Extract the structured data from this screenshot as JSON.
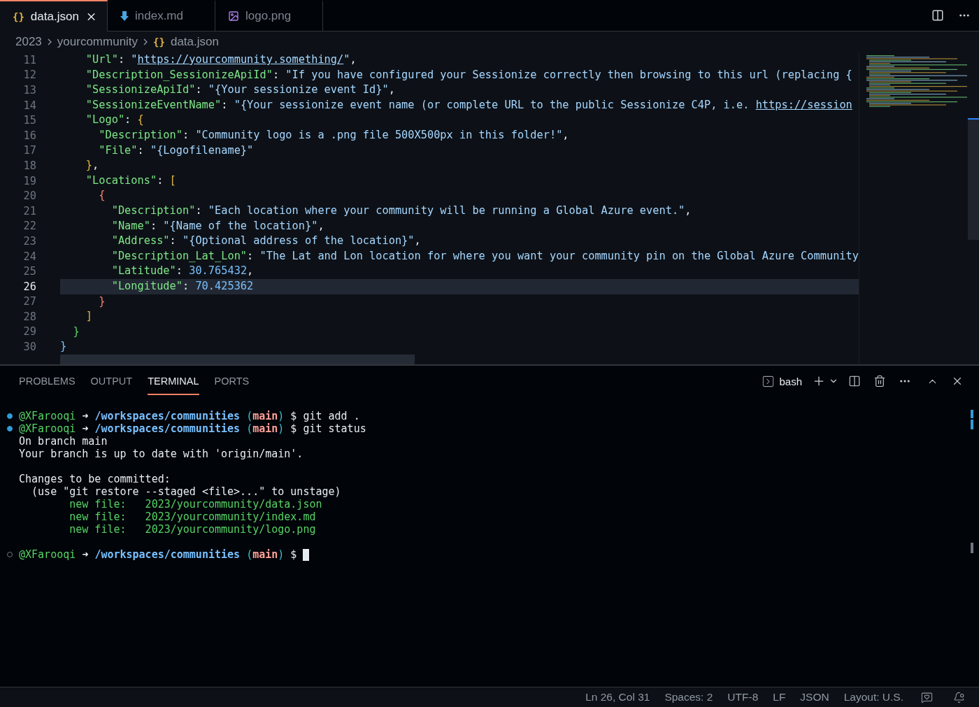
{
  "tabs": [
    {
      "kind": "json",
      "glyph": "{}",
      "label": "data.json",
      "selected": true
    },
    {
      "kind": "markdown",
      "label": "index.md",
      "selected": false
    },
    {
      "kind": "image",
      "label": "logo.png",
      "selected": false
    }
  ],
  "breadcrumb": [
    {
      "label": "2023"
    },
    {
      "label": "yourcommunity"
    },
    {
      "glyph": "{}",
      "label": "data.json"
    }
  ],
  "editor": {
    "lines": [
      {
        "number": "11",
        "current": false,
        "tokens": [
          {
            "kind": "key",
            "text": "    \"Url\""
          },
          {
            "kind": "punct",
            "text": ": "
          },
          {
            "kind": "string",
            "text": "\""
          },
          {
            "kind": "link",
            "text": "https://yourcommunity.something/"
          },
          {
            "kind": "string",
            "text": "\""
          },
          {
            "kind": "punct",
            "text": ","
          }
        ]
      },
      {
        "number": "12",
        "current": false,
        "tokens": [
          {
            "kind": "key",
            "text": "    \"Description_SessionizeApiId\""
          },
          {
            "kind": "punct",
            "text": ": "
          },
          {
            "kind": "string",
            "text": "\"If you have configured your Sessionize correctly then browsing to this url (replacing {"
          }
        ]
      },
      {
        "number": "13",
        "current": false,
        "tokens": [
          {
            "kind": "key",
            "text": "    \"SessionizeApiId\""
          },
          {
            "kind": "punct",
            "text": ": "
          },
          {
            "kind": "string",
            "text": "\"{Your sessionize event Id}\""
          },
          {
            "kind": "punct",
            "text": ","
          }
        ]
      },
      {
        "number": "14",
        "current": false,
        "tokens": [
          {
            "kind": "key",
            "text": "    \"SessionizeEventName\""
          },
          {
            "kind": "punct",
            "text": ": "
          },
          {
            "kind": "string",
            "text": "\"{Your sessionize event name (or complete URL to the public Sessionize C4P, i.e. "
          },
          {
            "kind": "link",
            "text": "https://session"
          }
        ]
      },
      {
        "number": "15",
        "current": false,
        "tokens": [
          {
            "kind": "key",
            "text": "    \"Logo\""
          },
          {
            "kind": "punct",
            "text": ": "
          },
          {
            "kind": "bracket",
            "text": "{",
            "color": "#e3b341"
          }
        ]
      },
      {
        "number": "16",
        "current": false,
        "tokens": [
          {
            "kind": "key",
            "text": "      \"Description\""
          },
          {
            "kind": "punct",
            "text": ": "
          },
          {
            "kind": "string",
            "text": "\"Community logo is a .png file 500X500px in this folder!\""
          },
          {
            "kind": "punct",
            "text": ","
          }
        ]
      },
      {
        "number": "17",
        "current": false,
        "tokens": [
          {
            "kind": "key",
            "text": "      \"File\""
          },
          {
            "kind": "punct",
            "text": ": "
          },
          {
            "kind": "string",
            "text": "\"{Logofilename}\""
          }
        ]
      },
      {
        "number": "18",
        "current": false,
        "tokens": [
          {
            "kind": "bracket",
            "text": "    }",
            "color": "#e3b341"
          },
          {
            "kind": "punct",
            "text": ","
          }
        ]
      },
      {
        "number": "19",
        "current": false,
        "tokens": [
          {
            "kind": "key",
            "text": "    \"Locations\""
          },
          {
            "kind": "punct",
            "text": ": "
          },
          {
            "kind": "bracket",
            "text": "[",
            "color": "#e3b341"
          }
        ]
      },
      {
        "number": "20",
        "current": false,
        "tokens": [
          {
            "kind": "bracket",
            "text": "      {",
            "color": "#ff7b72"
          }
        ]
      },
      {
        "number": "21",
        "current": false,
        "tokens": [
          {
            "kind": "key",
            "text": "        \"Description\""
          },
          {
            "kind": "punct",
            "text": ": "
          },
          {
            "kind": "string",
            "text": "\"Each location where your community will be running a Global Azure event.\""
          },
          {
            "kind": "punct",
            "text": ","
          }
        ]
      },
      {
        "number": "22",
        "current": false,
        "tokens": [
          {
            "kind": "key",
            "text": "        \"Name\""
          },
          {
            "kind": "punct",
            "text": ": "
          },
          {
            "kind": "string",
            "text": "\"{Name of the location}\""
          },
          {
            "kind": "punct",
            "text": ","
          }
        ]
      },
      {
        "number": "23",
        "current": false,
        "tokens": [
          {
            "kind": "key",
            "text": "        \"Address\""
          },
          {
            "kind": "punct",
            "text": ": "
          },
          {
            "kind": "string",
            "text": "\"{Optional address of the location}\""
          },
          {
            "kind": "punct",
            "text": ","
          }
        ]
      },
      {
        "number": "24",
        "current": false,
        "tokens": [
          {
            "kind": "key",
            "text": "        \"Description_Lat_Lon\""
          },
          {
            "kind": "punct",
            "text": ": "
          },
          {
            "kind": "string",
            "text": "\"The Lat and Lon location for where you want your community pin on the Global Azure Community"
          }
        ]
      },
      {
        "number": "25",
        "current": false,
        "tokens": [
          {
            "kind": "key",
            "text": "        \"Latitude\""
          },
          {
            "kind": "punct",
            "text": ": "
          },
          {
            "kind": "number",
            "text": "30.765432"
          },
          {
            "kind": "punct",
            "text": ","
          }
        ]
      },
      {
        "number": "26",
        "current": true,
        "tokens": [
          {
            "kind": "key",
            "text": "        \"Longitude\""
          },
          {
            "kind": "punct",
            "text": ": "
          },
          {
            "kind": "number",
            "text": "70.425362"
          }
        ]
      },
      {
        "number": "27",
        "current": false,
        "tokens": [
          {
            "kind": "bracket",
            "text": "      }",
            "color": "#ff7b72"
          }
        ]
      },
      {
        "number": "28",
        "current": false,
        "tokens": [
          {
            "kind": "bracket",
            "text": "    ]",
            "color": "#e3b341"
          }
        ]
      },
      {
        "number": "29",
        "current": false,
        "tokens": [
          {
            "kind": "bracket",
            "text": "  }",
            "color": "#56d364"
          }
        ]
      },
      {
        "number": "30",
        "current": false,
        "tokens": [
          {
            "kind": "bracket",
            "text": "}",
            "color": "#79c0ff"
          }
        ]
      }
    ]
  },
  "panel": {
    "tabs": [
      {
        "label": "PROBLEMS",
        "selected": false
      },
      {
        "label": "OUTPUT",
        "selected": false
      },
      {
        "label": "TERMINAL",
        "selected": true
      },
      {
        "label": "PORTS",
        "selected": false
      }
    ],
    "shell": "bash"
  },
  "terminal": {
    "lines": [
      {
        "kind": "prompt",
        "completed": true,
        "user": "@XFarooqi",
        "arrow": "➜",
        "path": "/workspaces/communities",
        "paren_open": "(",
        "branch": "main",
        "paren_close": ")",
        "command": "$ git add ."
      },
      {
        "kind": "prompt",
        "completed": true,
        "user": "@XFarooqi",
        "arrow": "➜",
        "path": "/workspaces/communities",
        "paren_open": "(",
        "branch": "main",
        "paren_close": ")",
        "command": "$ git status"
      },
      {
        "kind": "output",
        "text": "On branch main"
      },
      {
        "kind": "output",
        "text": "Your branch is up to date with 'origin/main'."
      },
      {
        "kind": "blank"
      },
      {
        "kind": "output",
        "text": "Changes to be committed:"
      },
      {
        "kind": "output",
        "text": "  (use \"git restore --staged <file>...\" to unstage)"
      },
      {
        "kind": "staged",
        "label": "new file:",
        "path": "2023/yourcommunity/data.json"
      },
      {
        "kind": "staged",
        "label": "new file:",
        "path": "2023/yourcommunity/index.md"
      },
      {
        "kind": "staged",
        "label": "new file:",
        "path": "2023/yourcommunity/logo.png"
      },
      {
        "kind": "blank"
      },
      {
        "kind": "prompt",
        "completed": false,
        "user": "@XFarooqi",
        "arrow": "➜",
        "path": "/workspaces/communities",
        "paren_open": "(",
        "branch": "main",
        "paren_close": ")",
        "command": "$",
        "cursor": true
      }
    ]
  },
  "status_bar": {
    "items": [
      "Ln 26, Col 31",
      "Spaces: 2",
      "UTF-8",
      "LF",
      "JSON",
      "Layout: U.S."
    ]
  }
}
